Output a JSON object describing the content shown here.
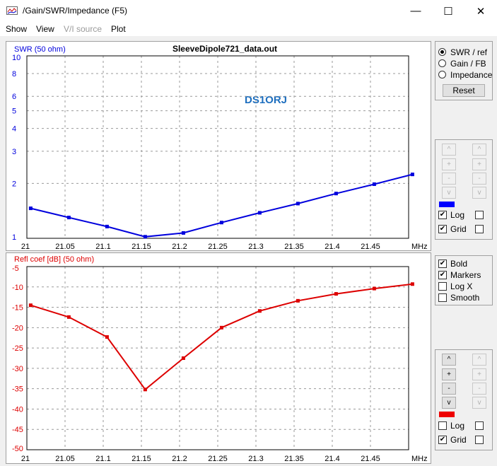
{
  "window": {
    "title": "/Gain/SWR/Impedance (F5)",
    "min_glyph": "—",
    "max_glyph": "☐",
    "close_glyph": "✕"
  },
  "menu": {
    "show": "Show",
    "view": "View",
    "vi_source": "V/I source",
    "plot": "Plot"
  },
  "colors": {
    "swr": "#0000dd",
    "refl": "#dd0000",
    "annotation": "#1e6fbf"
  },
  "plot1": {
    "title": "SleeveDipole721_data.out",
    "annotation": "DS1ORJ",
    "unit": "MHz",
    "chart_data": {
      "type": "line",
      "ylabel": "SWR (50 ohm)",
      "yscale": "log",
      "ylim": [
        1,
        10
      ],
      "yticks": [
        "10",
        "8",
        "6",
        "5",
        "4",
        "3",
        "2",
        "1"
      ],
      "xticks": [
        "21",
        "21.05",
        "21.1",
        "21.15",
        "21.2",
        "21.25",
        "21.3",
        "21.35",
        "21.4",
        "21.45"
      ],
      "xlim": [
        21,
        21.5
      ],
      "series": [
        {
          "x": [
            21.005,
            21.055,
            21.105,
            21.155,
            21.205,
            21.255,
            21.305,
            21.355,
            21.405,
            21.455,
            21.505
          ],
          "y": [
            1.46,
            1.3,
            1.16,
            1.02,
            1.07,
            1.22,
            1.38,
            1.55,
            1.76,
            1.98,
            2.24
          ]
        }
      ]
    }
  },
  "plot2": {
    "unit": "MHz",
    "chart_data": {
      "type": "line",
      "ylabel": "Refl coef [dB] (50 ohm)",
      "ylim": [
        -50,
        -5
      ],
      "yticks": [
        "-5",
        "-10",
        "-15",
        "-20",
        "-25",
        "-30",
        "-35",
        "-40",
        "-45",
        "-50"
      ],
      "xticks": [
        "21",
        "21.05",
        "21.1",
        "21.15",
        "21.2",
        "21.25",
        "21.3",
        "21.35",
        "21.4",
        "21.45"
      ],
      "xlim": [
        21,
        21.5
      ],
      "series": [
        {
          "x": [
            21.005,
            21.055,
            21.105,
            21.155,
            21.205,
            21.255,
            21.305,
            21.355,
            21.405,
            21.455,
            21.505
          ],
          "y": [
            -14.5,
            -17.4,
            -22.3,
            -35.2,
            -27.5,
            -20.0,
            -15.9,
            -13.4,
            -11.7,
            -10.4,
            -9.3
          ]
        }
      ]
    }
  },
  "panel_top": {
    "swr_ref": "SWR / ref",
    "gain_fb": "Gain / FB",
    "impedance": "Impedance",
    "reset": "Reset"
  },
  "scale1": {
    "up": "^",
    "plus": "+",
    "minus": "-",
    "down": "v",
    "log": "Log",
    "grid": "Grid"
  },
  "panel_mid": {
    "bold": "Bold",
    "markers": "Markers",
    "logx": "Log X",
    "smooth": "Smooth"
  },
  "scale2": {
    "up": "^",
    "plus": "+",
    "minus": "-",
    "down": "v",
    "log": "Log",
    "grid": "Grid"
  }
}
